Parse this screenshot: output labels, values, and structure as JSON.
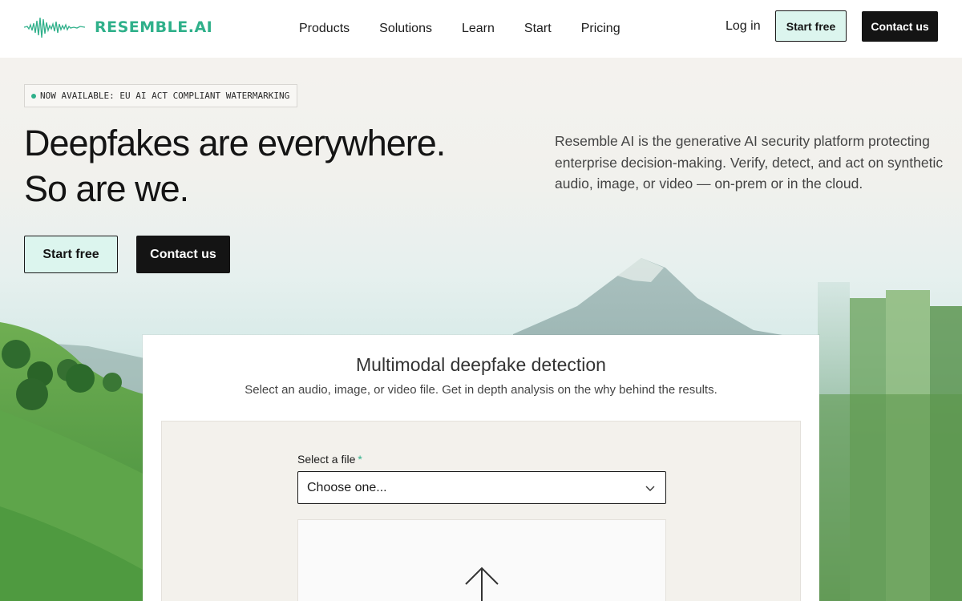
{
  "header": {
    "brand": "RESEMBLE.AI",
    "nav": [
      "Products",
      "Solutions",
      "Learn",
      "Start",
      "Pricing"
    ],
    "login_label": "Log in",
    "start_free_label": "Start free",
    "contact_label": "Contact us"
  },
  "hero": {
    "badge": "NOW AVAILABLE: EU AI ACT COMPLIANT WATERMARKING",
    "title_line1": "Deepfakes are everywhere.",
    "title_line2": "So are we.",
    "description": "Resemble AI is the generative AI security platform protecting enterprise decision-making. Verify, detect, and act on synthetic audio, image, or video — on-prem or in the cloud.",
    "start_free_label": "Start free",
    "contact_label": "Contact us"
  },
  "detector": {
    "title": "Multimodal deepfake detection",
    "subtitle": "Select an audio, image, or video file. Get in depth analysis on the why behind the results.",
    "field_label": "Select a file",
    "required_mark": "*",
    "select_value": "Choose one..."
  },
  "colors": {
    "accent": "#2fb08a",
    "mint": "#dcf5ee",
    "dark": "#141414"
  },
  "icons": {
    "logo": "waveform-icon",
    "select": "chevron-down-icon",
    "upload": "arrow-up-icon"
  }
}
